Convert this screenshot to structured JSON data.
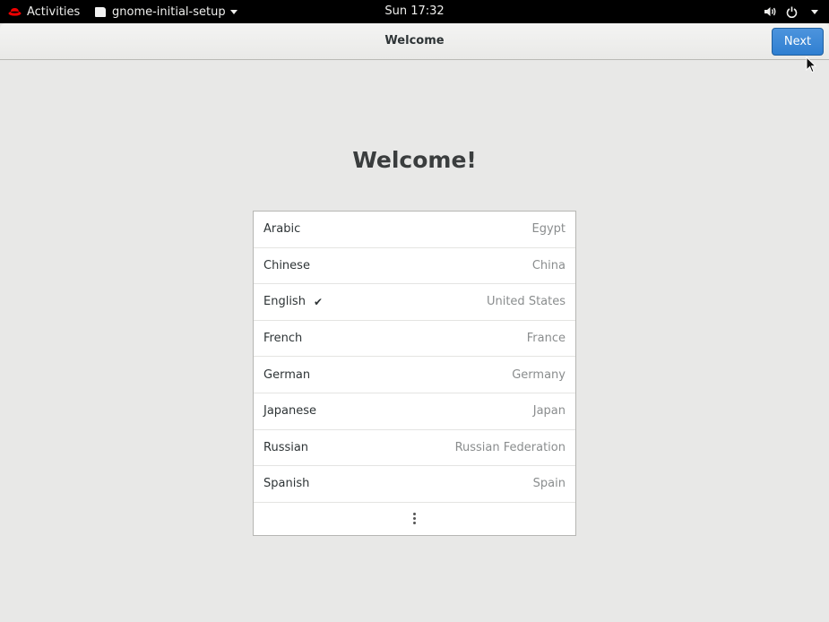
{
  "topbar": {
    "activities": "Activities",
    "app_name": "gnome-initial-setup",
    "clock": "Sun 17:32"
  },
  "header": {
    "title": "Welcome",
    "next_label": "Next"
  },
  "main": {
    "heading": "Welcome!",
    "languages": [
      {
        "language": "Arabic",
        "country": "Egypt",
        "selected": false
      },
      {
        "language": "Chinese",
        "country": "China",
        "selected": false
      },
      {
        "language": "English",
        "country": "United States",
        "selected": true
      },
      {
        "language": "French",
        "country": "France",
        "selected": false
      },
      {
        "language": "German",
        "country": "Germany",
        "selected": false
      },
      {
        "language": "Japanese",
        "country": "Japan",
        "selected": false
      },
      {
        "language": "Russian",
        "country": "Russian Federation",
        "selected": false
      },
      {
        "language": "Spanish",
        "country": "Spain",
        "selected": false
      }
    ]
  },
  "icons": {
    "distro": "redhat-icon",
    "app": "app-window-icon",
    "volume": "volume-icon",
    "power": "power-icon",
    "more": "more-vertical-icon"
  },
  "colors": {
    "accent": "#3584e4",
    "topbar": "#000000",
    "background": "#e8e8e7"
  }
}
